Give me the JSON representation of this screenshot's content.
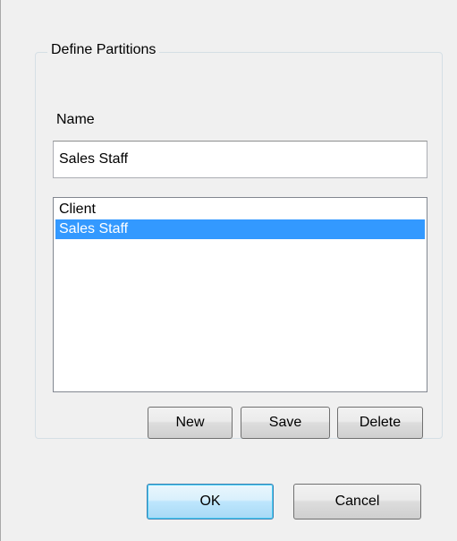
{
  "group": {
    "title": "Define Partitions"
  },
  "name_field": {
    "label": "Name",
    "value": "Sales Staff"
  },
  "partitions": {
    "items": [
      {
        "label": "Client",
        "selected": false
      },
      {
        "label": "Sales Staff",
        "selected": true
      }
    ],
    "selection_color": "#3399ff"
  },
  "list_buttons": {
    "new_label": "New",
    "save_label": "Save",
    "delete_label": "Delete"
  },
  "dialog_buttons": {
    "ok_label": "OK",
    "cancel_label": "Cancel"
  }
}
